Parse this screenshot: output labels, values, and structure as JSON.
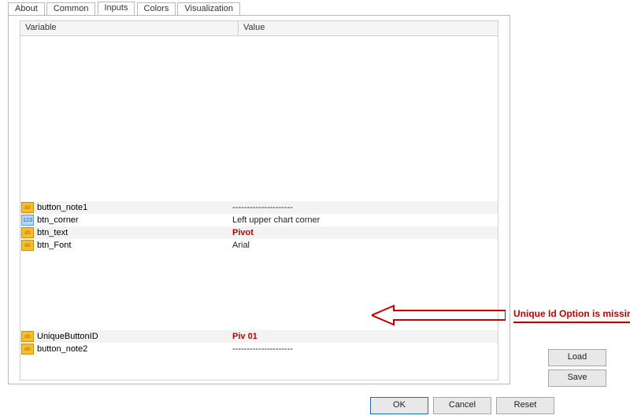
{
  "tabs": {
    "about": "About",
    "common": "Common",
    "inputs": "Inputs",
    "colors": "Colors",
    "visualization": "Visualization"
  },
  "headers": {
    "variable": "Variable",
    "value": "Value"
  },
  "rows_a": [
    {
      "icon": "ab",
      "name": "button_note1",
      "value": "---------------------",
      "value_red": false
    },
    {
      "icon": "123",
      "name": "btn_corner",
      "value": "Left upper chart corner",
      "value_red": false
    },
    {
      "icon": "ab",
      "name": "btn_text",
      "value": "Pivot",
      "value_red": true
    },
    {
      "icon": "ab",
      "name": "btn_Font",
      "value": "Arial",
      "value_red": false
    }
  ],
  "rows_b": [
    {
      "icon": "ab",
      "name": "UniqueButtonID",
      "value": "Piv 01",
      "value_red": true
    },
    {
      "icon": "ab",
      "name": "button_note2",
      "value": "---------------------",
      "value_red": false
    }
  ],
  "buttons": {
    "load": "Load",
    "save": "Save",
    "ok": "OK",
    "cancel": "Cancel",
    "reset": "Reset"
  },
  "annotation": {
    "text": "Unique Id Option is missing"
  }
}
